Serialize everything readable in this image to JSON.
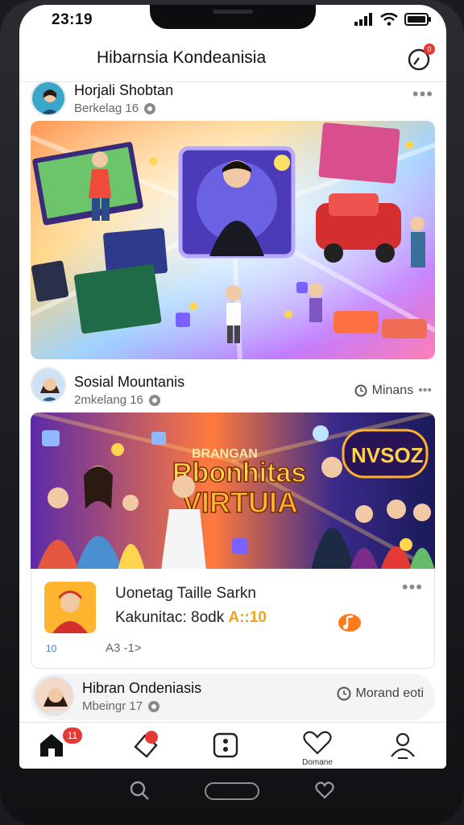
{
  "status_bar": {
    "time": "23:19"
  },
  "header": {
    "title": "Hibarnsia Kondeanisia",
    "notif_badge": "0"
  },
  "posts": [
    {
      "name": "Horjali Shobtan",
      "meta": "Berkelag 16"
    },
    {
      "name": "Sosial Mountanis",
      "meta": "2mkelang 16",
      "action_label": "Minans"
    }
  ],
  "banner2": {
    "title_line1": "Rbonhitas",
    "title_line2": "VIRTUIA",
    "neon": "NVSOZ",
    "sign_small": "BRANGAN"
  },
  "video_card": {
    "title": "Uonetag Taille Sarkn",
    "sub_prefix": "Kakunitac: 8odk",
    "sub_highlight": "A::10",
    "foot": "A3 -1>",
    "small": "10"
  },
  "bottom_post": {
    "name": "Hibran Ondeniasis",
    "meta": "Mbeingr 17",
    "action_label": "Morand eoti"
  },
  "tabbar": {
    "home_badge": "11",
    "favorites_label": "Domane"
  },
  "colors": {
    "badge": "#e53935",
    "accent": "#f0a11a"
  }
}
